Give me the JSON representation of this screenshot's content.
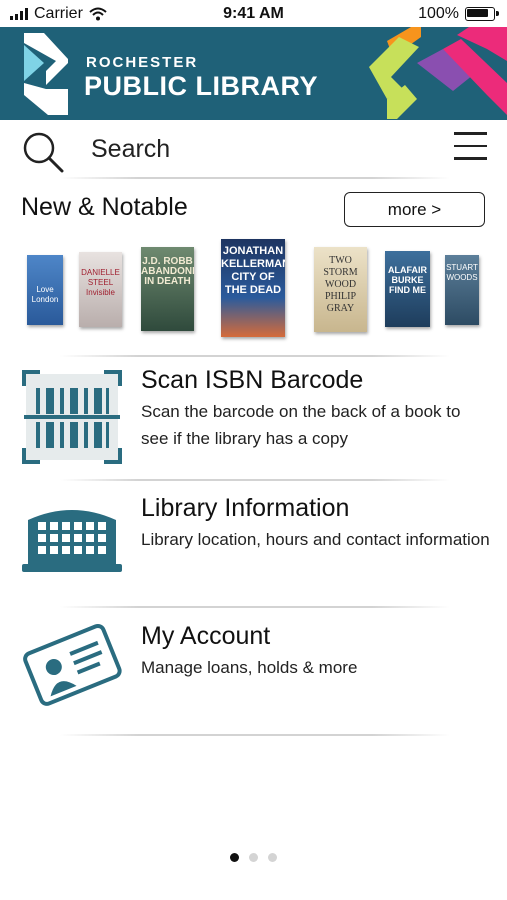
{
  "status_bar": {
    "carrier": "Carrier",
    "time": "9:41 AM",
    "battery": "100%"
  },
  "header": {
    "line1": "ROCHESTER",
    "line2": "PUBLIC LIBRARY"
  },
  "search": {
    "placeholder": "Search"
  },
  "new_notable": {
    "title": "New & Notable",
    "more_label": "more >",
    "books": [
      {
        "cover_text": "Love London",
        "color": "#3b6fb3"
      },
      {
        "cover_text": "DANIELLE STEEL Invisible",
        "color": "#cfc5c2"
      },
      {
        "cover_text": "J.D. ROBB ABANDONED IN DEATH",
        "color": "#4d6a55"
      },
      {
        "cover_text": "JONATHAN KELLERMAN CITY OF THE DEAD",
        "color": "#1c3f72"
      },
      {
        "cover_text": "TWO STORM WOOD PHILIP GRAY",
        "color": "#d9c9a6"
      },
      {
        "cover_text": "ALAFAIR BURKE FIND ME",
        "color": "#2e5a82"
      },
      {
        "cover_text": "STUART WOODS",
        "color": "#3a5d7a"
      }
    ]
  },
  "items": [
    {
      "title": "Scan ISBN Barcode",
      "desc": "Scan the barcode on the back of a book to see if the library has a copy",
      "icon": "barcode-icon"
    },
    {
      "title": "Library Information",
      "desc": "Library location, hours and contact information",
      "icon": "library-building-icon"
    },
    {
      "title": "My Account",
      "desc": "Manage loans, holds & more",
      "icon": "id-card-icon"
    }
  ],
  "colors": {
    "brand": "#1f6178",
    "icon": "#2a6c80"
  }
}
